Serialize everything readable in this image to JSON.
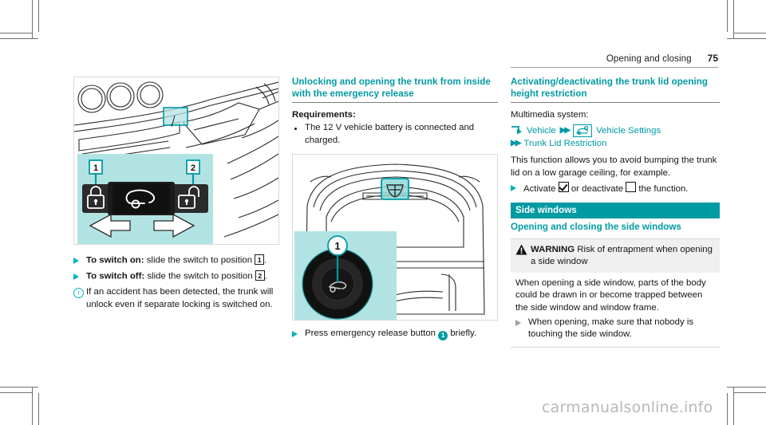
{
  "header": {
    "title": "Opening and closing",
    "page_number": "75"
  },
  "left_column": {
    "figure": {
      "name": "separate-trunk-locking-switch-illustration",
      "callouts": [
        "1",
        "2"
      ],
      "icons": [
        "locked-padlock-icon",
        "trunk-key-icon",
        "unlocked-padlock-icon"
      ],
      "arrows": [
        "arrow-left",
        "arrow-right"
      ]
    },
    "items": [
      {
        "marker": "triangle",
        "bold": "To switch on:",
        "text": " slide the switch to position ",
        "callout": "1",
        "tail": "."
      },
      {
        "marker": "triangle",
        "bold": "To switch off:",
        "text": " slide the switch to position ",
        "callout": "2",
        "tail": "."
      },
      {
        "marker": "info",
        "text": "If an accident has been detected, the trunk will unlock even if separate locking is switched on."
      }
    ]
  },
  "middle_column": {
    "heading": "Unlocking and opening the trunk from inside with the emergency release",
    "requirements_label": "Requirements:",
    "requirements": [
      "The 12 V vehicle battery is connected and charged."
    ],
    "figure": {
      "name": "trunk-emergency-release-illustration",
      "callouts": [
        "1"
      ],
      "icons": [
        "trunk-emblem-icon",
        "emergency-release-button-icon"
      ]
    },
    "instruction": {
      "marker": "triangle",
      "text_before": "Press emergency release button ",
      "callout": "1",
      "text_after": " briefly."
    }
  },
  "right_column": {
    "heading": "Activating/deactivating the trunk lid opening height restriction",
    "multimedia_label": "Multimedia system:",
    "nav_path": {
      "start_icon": "menu-arrow-icon",
      "item1": "Vehicle",
      "separator1": "chevron-double-right-icon",
      "item2_icon": "vehicle-settings-icon",
      "item2": "Vehicle Settings",
      "separator2": "chevron-double-right-icon",
      "item3": "Trunk Lid Restriction"
    },
    "description": "This function allows you to avoid bumping the trunk lid on a low garage ceiling, for example.",
    "action": {
      "marker": "triangle",
      "text_before": "Activate ",
      "checkbox_checked": "checked-checkbox-icon",
      "text_middle": " or deactivate ",
      "checkbox_unchecked": "unchecked-checkbox-icon",
      "text_after": " the function."
    },
    "section_band": "Side windows",
    "subheading": "Opening and closing the side windows",
    "warning": {
      "icon": "warning-triangle-icon",
      "label": "WARNING",
      "title": " Risk of entrapment when opening a side window",
      "body": "When opening a side window, parts of the body could be drawn in or become trapped between the side window and window frame.",
      "action_marker": "triangle-grey",
      "action": "When opening, make sure that nobody is touching the side window."
    }
  },
  "watermark": "carmanualsonline.info",
  "colors": {
    "teal": "#009aa3",
    "teal_bright": "#00b3bb",
    "panel_teal": "#b2e3e3",
    "warning_bg": "#f0f0f0"
  }
}
